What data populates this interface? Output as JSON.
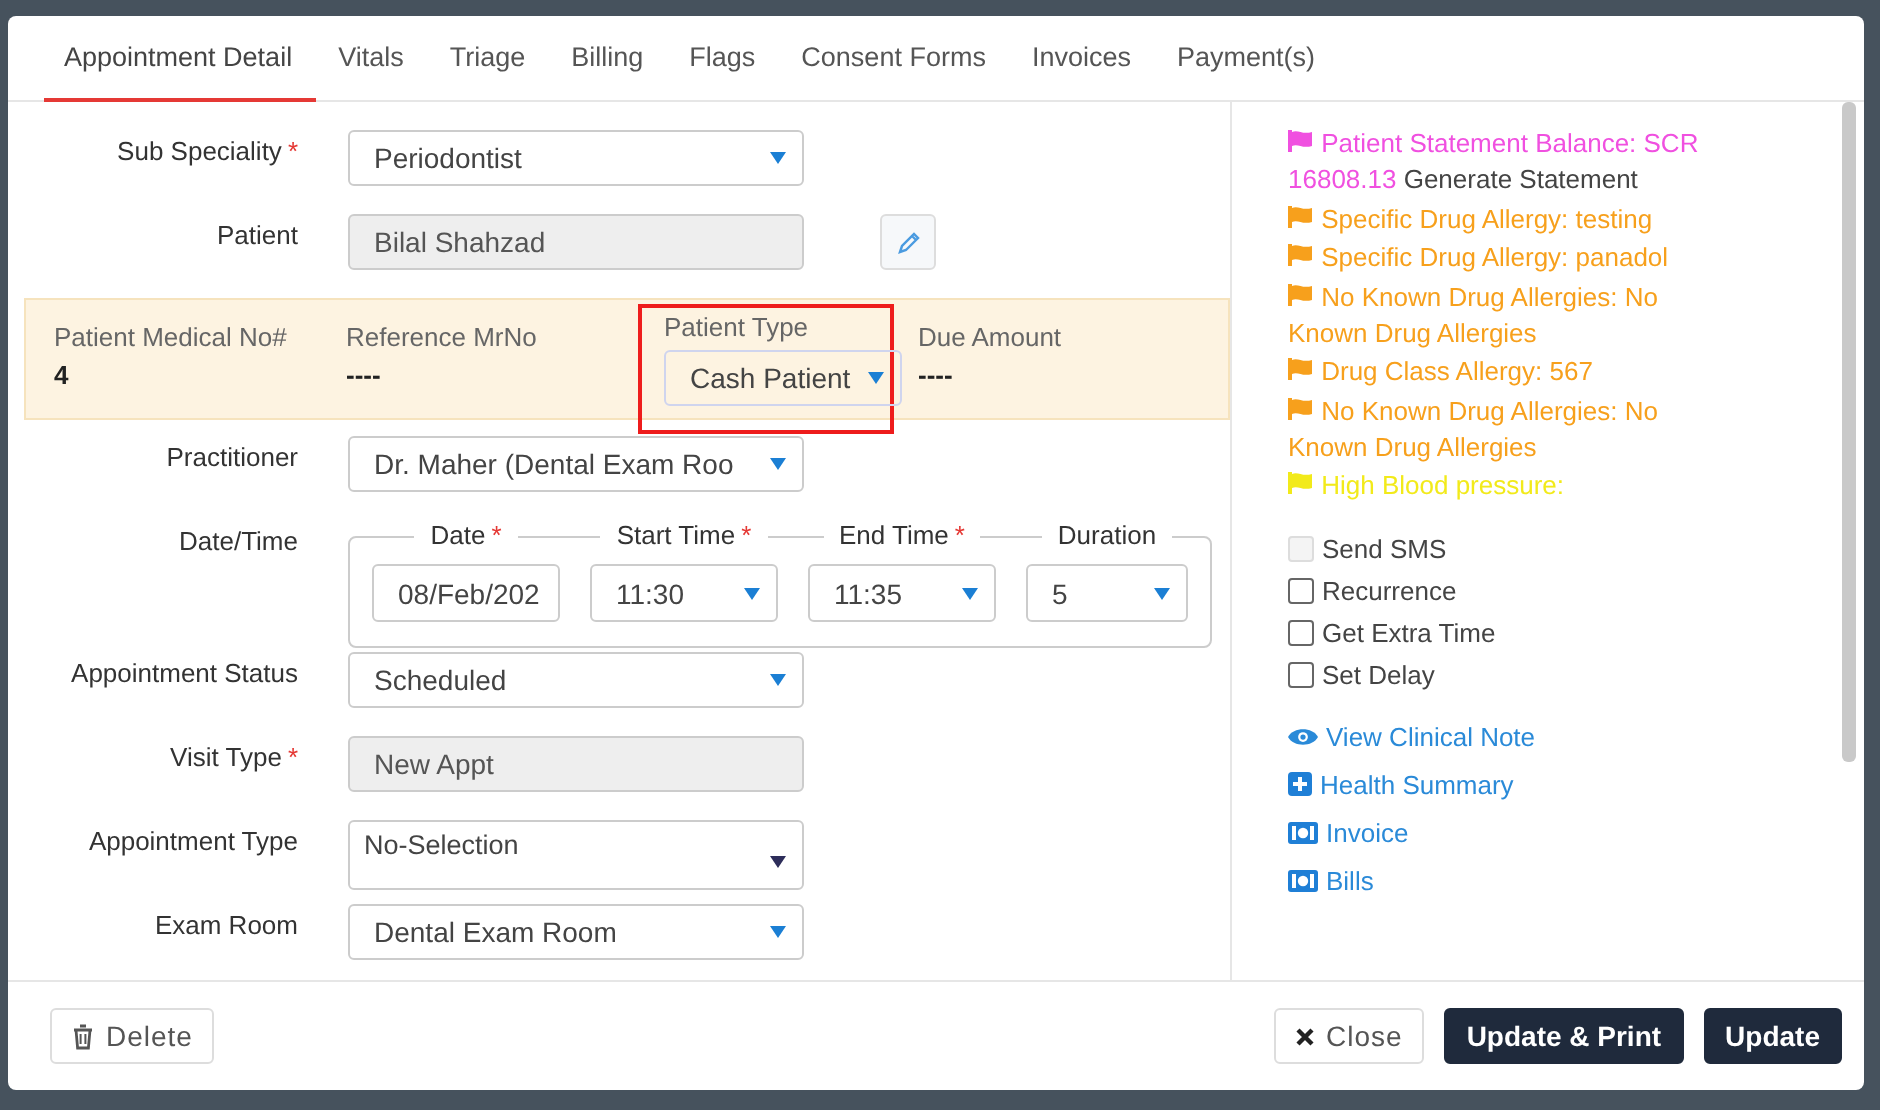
{
  "tabs": [
    {
      "label": "Appointment Detail",
      "selected": true
    },
    {
      "label": "Vitals",
      "selected": false
    },
    {
      "label": "Triage",
      "selected": false
    },
    {
      "label": "Billing",
      "selected": false
    },
    {
      "label": "Flags",
      "selected": false
    },
    {
      "label": "Consent Forms",
      "selected": false
    },
    {
      "label": "Invoices",
      "selected": false
    },
    {
      "label": "Payment(s)",
      "selected": false
    }
  ],
  "form": [
    {
      "kind": "select",
      "label": "Sub Speciality",
      "required_mark": "*",
      "value": "Periodontist"
    },
    {
      "kind": "readonly",
      "label": "Patient",
      "value": "Bilal Shahzad",
      "editable": true
    },
    {
      "kind": "band",
      "items": [
        {
          "kind": "text",
          "label": "Patient Medical No#",
          "value": "4"
        },
        {
          "kind": "text",
          "label": "Reference MrNo",
          "value": "----"
        },
        {
          "kind": "select",
          "label": "Patient Type",
          "value": "Cash Patient",
          "highlighted": true
        },
        {
          "kind": "text",
          "label": "Due Amount",
          "value": "----"
        }
      ]
    },
    {
      "kind": "select",
      "label": "Practitioner",
      "value": "Dr. Maher (Dental Exam Roo"
    },
    {
      "kind": "datetime",
      "label": "Date/Time",
      "parts": [
        {
          "kind": "input",
          "label": "Date",
          "required_mark": "*",
          "value": "08/Feb/202"
        },
        {
          "kind": "select",
          "label": "Start Time",
          "required_mark": "*",
          "value": "11:30"
        },
        {
          "kind": "select",
          "label": "End Time",
          "required_mark": "*",
          "value": "11:35"
        },
        {
          "kind": "select",
          "label": "Duration",
          "value": "5"
        }
      ]
    },
    {
      "kind": "select",
      "label": "Appointment Status",
      "value": "Scheduled"
    },
    {
      "kind": "readonly",
      "label": "Visit Type",
      "required_mark": "*",
      "value": "New Appt"
    },
    {
      "kind": "multiselect",
      "label": "Appointment Type",
      "value": "No-Selection"
    },
    {
      "kind": "select",
      "label": "Exam Room",
      "value": "Dental Exam Room"
    }
  ],
  "flags": [
    {
      "text": "Patient Statement Balance: SCR 16808.13",
      "action": "Generate Statement",
      "color": "#f050e0"
    },
    {
      "text": "Specific Drug Allergy: testing",
      "color": "#f7a01c"
    },
    {
      "text": "Specific Drug Allergy: panadol",
      "color": "#f7a01c"
    },
    {
      "text": "No Known Drug Allergies: No Known Drug Allergies",
      "color": "#f7a01c"
    },
    {
      "text": "Drug Class Allergy: 567",
      "color": "#f7a01c"
    },
    {
      "text": "No Known Drug Allergies: No Known Drug Allergies",
      "color": "#f7a01c"
    },
    {
      "text": "High Blood pressure:",
      "color": "#f2ea1a"
    }
  ],
  "options": [
    {
      "label": "Send SMS",
      "checked": false,
      "disabled": true
    },
    {
      "label": "Recurrence",
      "checked": false,
      "disabled": false
    },
    {
      "label": "Get Extra Time",
      "checked": false,
      "disabled": false
    },
    {
      "label": "Set Delay",
      "checked": false,
      "disabled": false
    }
  ],
  "links": [
    {
      "kind": "eye",
      "label": "View Clinical Note"
    },
    {
      "kind": "plus",
      "label": "Health Summary"
    },
    {
      "kind": "money",
      "label": "Invoice"
    },
    {
      "kind": "money",
      "label": "Bills"
    }
  ],
  "footer": {
    "left": [
      {
        "kind": "delete",
        "label": "Delete"
      }
    ],
    "right": [
      {
        "kind": "close",
        "label": "Close"
      },
      {
        "kind": "primary",
        "label": "Update & Print"
      },
      {
        "kind": "primary",
        "label": "Update"
      }
    ]
  }
}
